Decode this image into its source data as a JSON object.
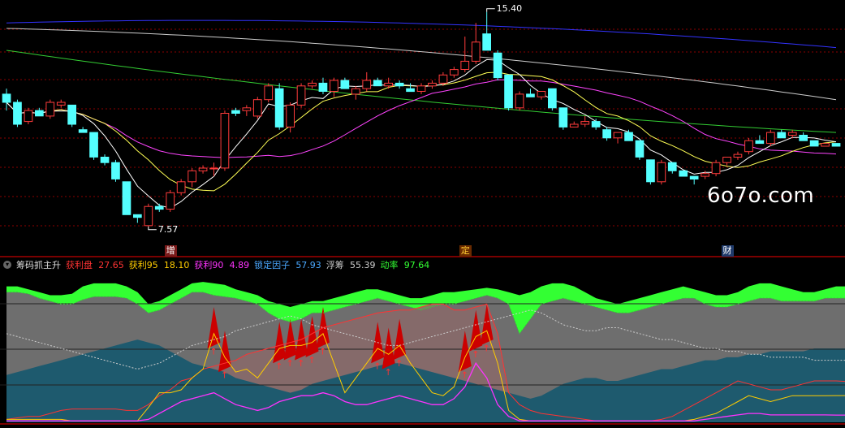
{
  "colors": {
    "up": "#ff3b3b",
    "down": "#54ffff",
    "ma5": "#ffffff",
    "ma10": "#ffff55",
    "ma20": "#ff44ff",
    "ma60": "#33cc33",
    "ma120": "#cccccc",
    "ma250": "#3333ff",
    "grid": "#8b0000"
  },
  "price_labels": {
    "high": "15.40",
    "low": "7.57"
  },
  "watermark": "6o7o.com",
  "markers": [
    {
      "text": "增",
      "bar": 15,
      "color": "#ffffff",
      "bg": "#7a1a1a"
    },
    {
      "text": "定",
      "bar": 42,
      "color": "#ffcc33",
      "bg": "#6b2b00"
    },
    {
      "text": "财",
      "bar": 66,
      "color": "#ffffff",
      "bg": "#1f3a6b"
    }
  ],
  "indicator": {
    "name": "筹码抓主升",
    "fields": [
      {
        "label": "获利盘",
        "value": "27.65",
        "color": "#ff3333"
      },
      {
        "label": "获利95",
        "value": "18.10",
        "color": "#ffcc00"
      },
      {
        "label": "获利90",
        "value": "4.89",
        "color": "#ff33ff"
      },
      {
        "label": "锁定因子",
        "value": "57.93",
        "color": "#4aa8ff"
      },
      {
        "label": "浮筹",
        "value": "55.39",
        "color": "#cccccc"
      },
      {
        "label": "动率",
        "value": "97.64",
        "color": "#33ff33"
      }
    ]
  },
  "chart_data": [
    {
      "type": "candlestick",
      "title": "",
      "ylim": [
        7.0,
        15.6
      ],
      "grid": true,
      "candles": [
        [
          12.4,
          12.6,
          11.8,
          12.1
        ],
        [
          12.1,
          12.2,
          11.2,
          11.3
        ],
        [
          11.4,
          11.9,
          11.3,
          11.8
        ],
        [
          11.8,
          11.9,
          11.7,
          11.6
        ],
        [
          11.6,
          12.2,
          11.5,
          12.1
        ],
        [
          12.0,
          12.2,
          11.9,
          12.1
        ],
        [
          12.0,
          12.0,
          11.2,
          11.3
        ],
        [
          11.1,
          11.2,
          11.0,
          11.0
        ],
        [
          11.0,
          11.0,
          10.0,
          10.1
        ],
        [
          10.1,
          10.2,
          9.8,
          9.9
        ],
        [
          9.9,
          10.0,
          9.2,
          9.3
        ],
        [
          9.2,
          9.2,
          8.0,
          8.0
        ],
        [
          8.0,
          8.0,
          7.7,
          7.9
        ],
        [
          7.6,
          8.4,
          7.57,
          8.3
        ],
        [
          8.3,
          8.4,
          8.1,
          8.2
        ],
        [
          8.2,
          8.9,
          8.1,
          8.8
        ],
        [
          8.8,
          9.3,
          8.7,
          9.2
        ],
        [
          9.2,
          9.7,
          9.0,
          9.6
        ],
        [
          9.6,
          9.8,
          9.5,
          9.7
        ],
        [
          9.7,
          9.9,
          9.4,
          9.7
        ],
        [
          9.7,
          11.8,
          9.6,
          11.7
        ],
        [
          11.8,
          11.9,
          11.6,
          11.7
        ],
        [
          11.8,
          12.0,
          11.6,
          11.9
        ],
        [
          11.6,
          12.3,
          11.5,
          12.2
        ],
        [
          12.2,
          12.8,
          12.1,
          12.7
        ],
        [
          12.6,
          12.8,
          11.1,
          11.2
        ],
        [
          11.2,
          12.1,
          11.0,
          12.0
        ],
        [
          12.0,
          12.8,
          11.9,
          12.7
        ],
        [
          12.7,
          12.9,
          12.6,
          12.8
        ],
        [
          12.8,
          13.0,
          12.4,
          12.5
        ],
        [
          12.5,
          13.0,
          12.3,
          12.9
        ],
        [
          12.9,
          13.0,
          12.6,
          12.6
        ],
        [
          12.4,
          12.7,
          12.2,
          12.6
        ],
        [
          12.6,
          13.2,
          12.5,
          12.9
        ],
        [
          12.9,
          13.0,
          12.7,
          12.7
        ],
        [
          12.7,
          13.0,
          12.6,
          12.8
        ],
        [
          12.8,
          12.9,
          12.6,
          12.7
        ],
        [
          12.6,
          12.8,
          12.5,
          12.5
        ],
        [
          12.5,
          12.8,
          12.4,
          12.7
        ],
        [
          12.7,
          12.9,
          12.6,
          12.8
        ],
        [
          12.8,
          13.2,
          12.7,
          13.1
        ],
        [
          13.1,
          13.4,
          13.0,
          13.3
        ],
        [
          13.3,
          14.5,
          13.2,
          13.6
        ],
        [
          13.6,
          15.0,
          13.5,
          14.3
        ],
        [
          14.6,
          15.4,
          14.2,
          14.0
        ],
        [
          13.9,
          14.0,
          12.9,
          13.0
        ],
        [
          13.1,
          13.1,
          11.8,
          11.9
        ],
        [
          11.9,
          12.5,
          11.8,
          12.4
        ],
        [
          12.4,
          12.6,
          12.3,
          12.3
        ],
        [
          12.3,
          12.5,
          12.2,
          12.5
        ],
        [
          12.6,
          12.6,
          11.8,
          11.9
        ],
        [
          11.9,
          11.9,
          11.1,
          11.2
        ],
        [
          11.2,
          11.4,
          11.2,
          11.3
        ],
        [
          11.3,
          11.6,
          11.2,
          11.4
        ],
        [
          11.4,
          11.5,
          11.1,
          11.2
        ],
        [
          11.1,
          11.2,
          10.7,
          10.8
        ],
        [
          10.8,
          11.0,
          10.6,
          11.0
        ],
        [
          11.0,
          11.1,
          10.7,
          10.7
        ],
        [
          10.7,
          10.7,
          10.0,
          10.1
        ],
        [
          10.0,
          10.0,
          9.1,
          9.2
        ],
        [
          9.2,
          10.0,
          9.1,
          9.9
        ],
        [
          9.9,
          9.9,
          9.5,
          9.6
        ],
        [
          9.6,
          9.6,
          9.4,
          9.4
        ],
        [
          9.4,
          9.4,
          9.1,
          9.3
        ],
        [
          9.4,
          9.6,
          9.3,
          9.5
        ],
        [
          9.5,
          10.0,
          9.4,
          9.9
        ],
        [
          9.9,
          10.1,
          9.8,
          10.1
        ],
        [
          10.1,
          10.3,
          10.0,
          10.2
        ],
        [
          10.3,
          10.8,
          10.2,
          10.7
        ],
        [
          10.7,
          10.9,
          10.6,
          10.6
        ],
        [
          10.6,
          11.1,
          10.5,
          11.0
        ],
        [
          11.0,
          11.1,
          10.8,
          10.8
        ],
        [
          10.9,
          11.1,
          10.8,
          11.0
        ],
        [
          10.9,
          11.0,
          10.7,
          10.7
        ],
        [
          10.7,
          10.7,
          10.5,
          10.5
        ],
        [
          10.5,
          10.6,
          10.5,
          10.6
        ],
        [
          10.6,
          10.6,
          10.5,
          10.5
        ]
      ]
    },
    {
      "type": "area",
      "title": "筹码抓主升",
      "ylim": [
        0,
        100
      ],
      "series": [
        {
          "name": "动率",
          "values": [
            92,
            92,
            90,
            88,
            86,
            86,
            87,
            92,
            94,
            94,
            94,
            92,
            88,
            80,
            82,
            86,
            90,
            94,
            95,
            94,
            93,
            90,
            88,
            86,
            82,
            80,
            78,
            80,
            82,
            82,
            84,
            86,
            88,
            90,
            90,
            88,
            86,
            84,
            84,
            86,
            88,
            88,
            89,
            90,
            91,
            90,
            88,
            86,
            88,
            92,
            94,
            94,
            92,
            88,
            84,
            82,
            80,
            82,
            84,
            86,
            88,
            90,
            92,
            90,
            88,
            86,
            86,
            88,
            92,
            94,
            94,
            92,
            90,
            88,
            88,
            90,
            92,
            92
          ]
        },
        {
          "name": "浮筹",
          "values": [
            88,
            88,
            87,
            84,
            82,
            80,
            80,
            83,
            85,
            85,
            85,
            84,
            80,
            74,
            76,
            80,
            84,
            88,
            88,
            86,
            85,
            84,
            82,
            80,
            74,
            70,
            68,
            70,
            74,
            74,
            76,
            78,
            80,
            82,
            84,
            82,
            80,
            78,
            76,
            78,
            80,
            80,
            82,
            84,
            86,
            84,
            80,
            60,
            70,
            80,
            82,
            84,
            82,
            80,
            78,
            76,
            74,
            74,
            76,
            78,
            80,
            82,
            84,
            84,
            80,
            78,
            78,
            80,
            82,
            84,
            84,
            82,
            82,
            82,
            82,
            84,
            84,
            84
          ]
        },
        {
          "name": "锁定因子",
          "values": [
            32,
            34,
            36,
            38,
            40,
            42,
            44,
            46,
            48,
            50,
            52,
            54,
            56,
            54,
            52,
            48,
            44,
            40,
            38,
            36,
            34,
            30,
            28,
            26,
            24,
            22,
            20,
            22,
            26,
            28,
            30,
            32,
            34,
            36,
            38,
            40,
            40,
            38,
            36,
            34,
            32,
            30,
            28,
            26,
            24,
            22,
            20,
            18,
            16,
            18,
            22,
            26,
            28,
            30,
            30,
            28,
            28,
            30,
            32,
            34,
            36,
            36,
            38,
            40,
            42,
            42,
            44,
            44,
            46,
            46,
            48,
            48,
            48,
            48,
            50,
            50,
            50,
            50
          ]
        },
        {
          "name": "获利盘",
          "values": [
            2,
            3,
            4,
            4,
            6,
            8,
            9,
            9,
            9,
            9,
            9,
            8,
            8,
            12,
            18,
            22,
            28,
            30,
            36,
            38,
            40,
            42,
            46,
            48,
            50,
            52,
            54,
            56,
            60,
            64,
            66,
            68,
            70,
            72,
            74,
            75,
            76,
            76,
            78,
            80,
            80,
            76,
            76,
            78,
            80,
            60,
            20,
            12,
            8,
            6,
            5,
            4,
            3,
            2,
            1,
            1,
            1,
            1,
            1,
            1,
            2,
            4,
            8,
            12,
            16,
            20,
            24,
            28,
            26,
            24,
            22,
            22,
            24,
            26,
            28,
            28,
            28,
            27.65
          ]
        },
        {
          "name": "获利95",
          "values": [
            2,
            2,
            2,
            2,
            2,
            2,
            1,
            1,
            1,
            1,
            1,
            1,
            1,
            10,
            20,
            20,
            22,
            30,
            36,
            60,
            44,
            34,
            36,
            30,
            40,
            50,
            52,
            52,
            54,
            60,
            40,
            20,
            30,
            40,
            50,
            46,
            52,
            40,
            30,
            20,
            18,
            24,
            44,
            58,
            62,
            40,
            8,
            2,
            1,
            1,
            1,
            1,
            1,
            1,
            1,
            1,
            1,
            1,
            1,
            1,
            1,
            1,
            1,
            2,
            4,
            6,
            10,
            14,
            18,
            16,
            14,
            16,
            18,
            18,
            18,
            18,
            18.1,
            18.1
          ]
        },
        {
          "name": "获利90",
          "values": [
            1,
            1,
            1,
            1,
            1,
            1,
            1,
            1,
            1,
            1,
            1,
            1,
            1,
            2,
            6,
            10,
            14,
            16,
            18,
            20,
            16,
            12,
            10,
            8,
            10,
            14,
            16,
            18,
            18,
            20,
            18,
            14,
            12,
            12,
            14,
            16,
            18,
            16,
            14,
            12,
            12,
            16,
            24,
            40,
            30,
            12,
            4,
            1,
            1,
            1,
            1,
            1,
            1,
            1,
            1,
            1,
            1,
            1,
            1,
            1,
            1,
            1,
            1,
            1,
            2,
            3,
            4,
            5,
            6,
            6,
            5,
            5,
            5,
            5,
            5,
            5,
            4.9,
            4.89
          ]
        }
      ]
    }
  ]
}
